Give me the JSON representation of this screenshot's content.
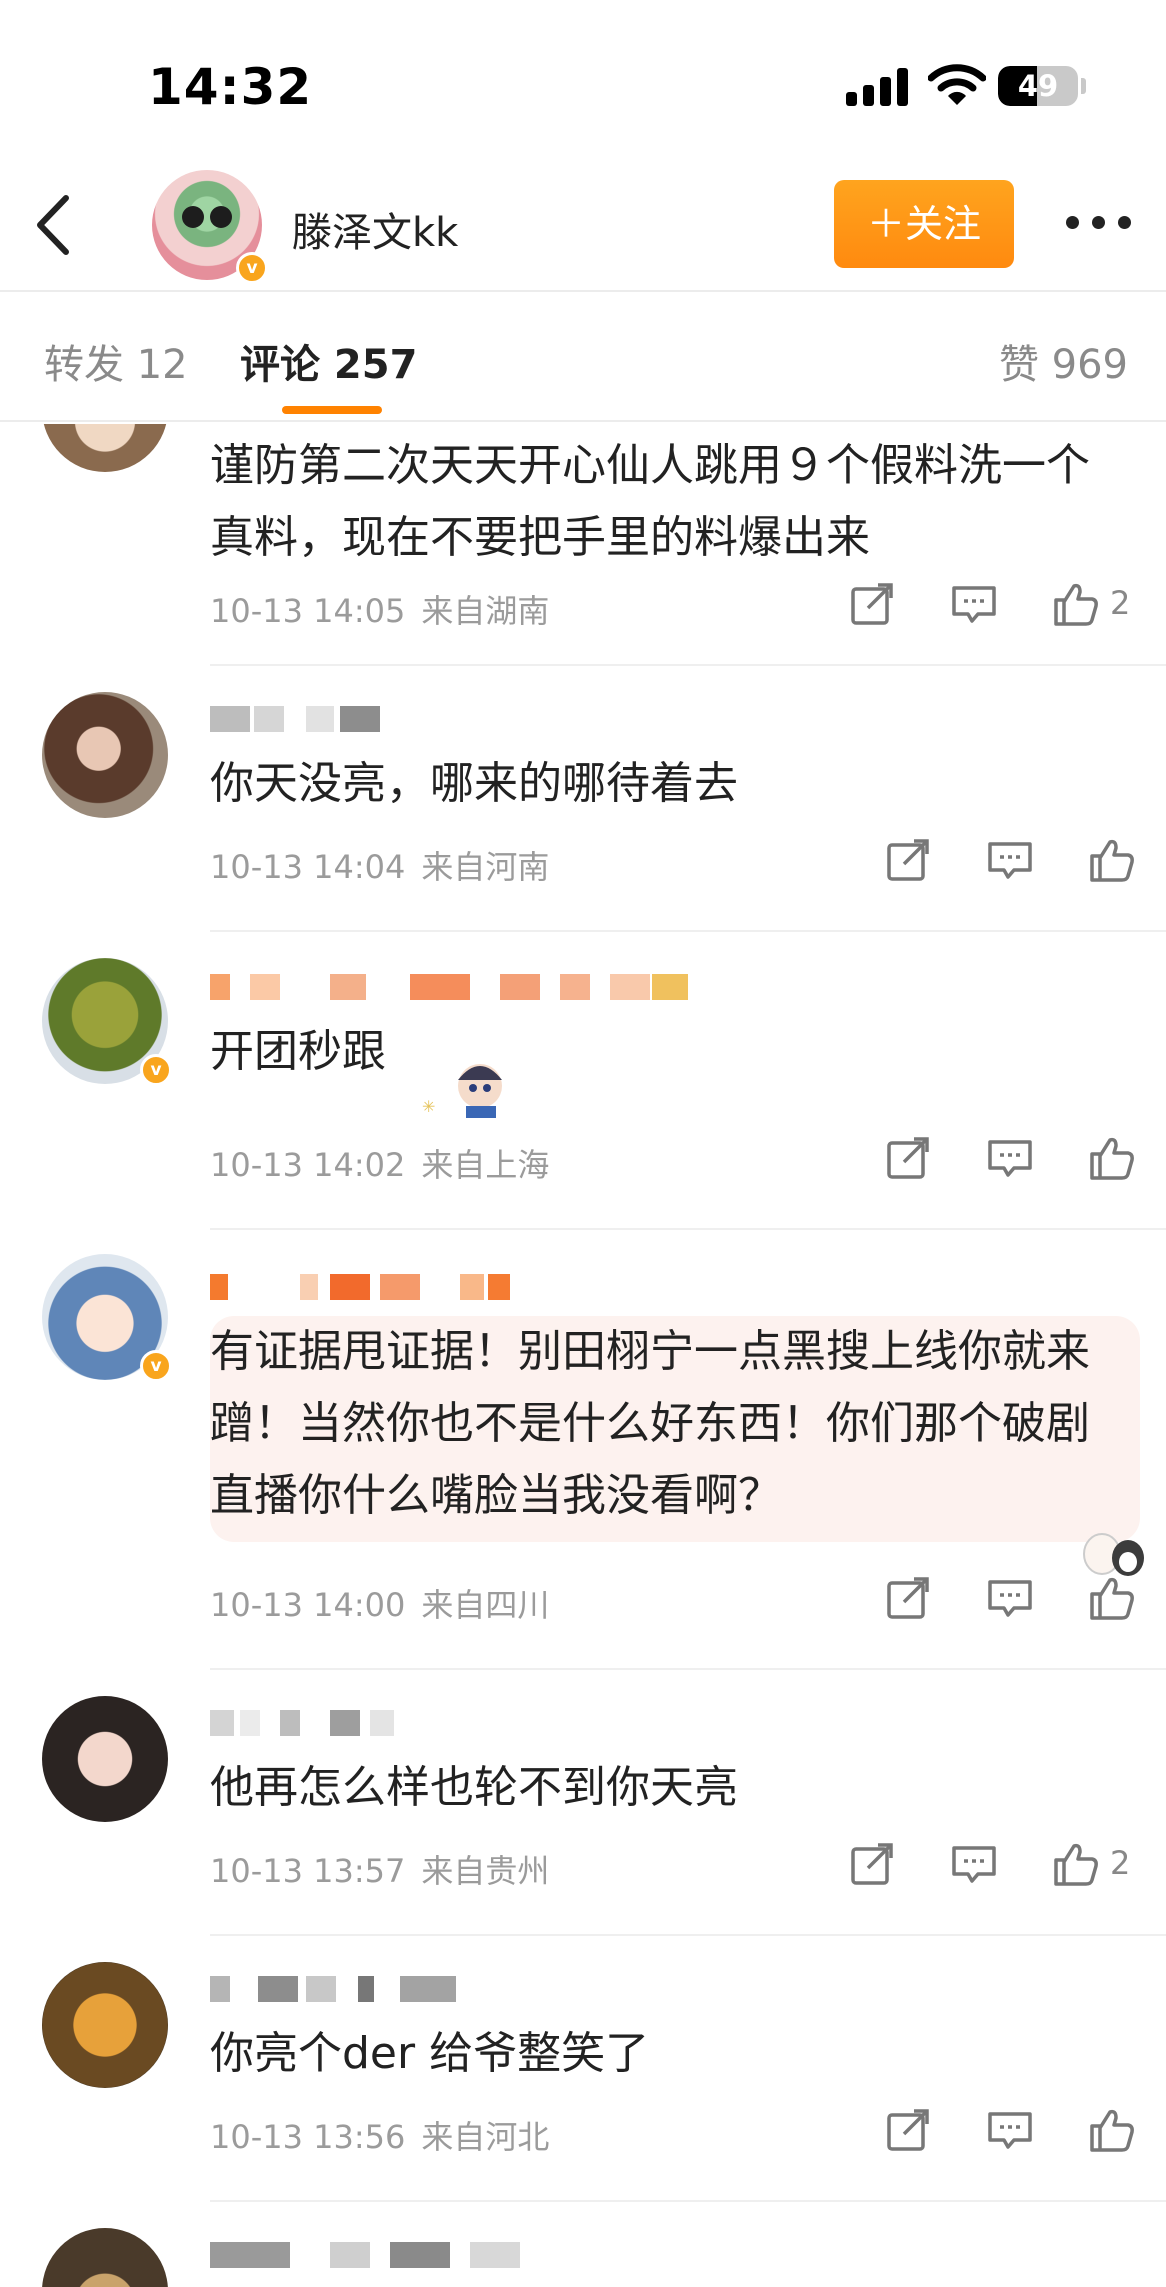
{
  "status_bar": {
    "time": "14:32",
    "battery": "49",
    "battery_level": 0.49
  },
  "header": {
    "profile_name": "滕泽文kk",
    "follow_label": "＋关注",
    "verified_mark": "v"
  },
  "tabs": {
    "repost": "转发 12",
    "comments": "评论 257",
    "likes": "赞 969"
  },
  "comments": [
    {
      "text": "谨防第二次天天开心仙人跳用９个假料洗一个真料，现在不要把手里的料爆出来",
      "time": "10-13 14:05",
      "location": "来自湖南",
      "likes": "2"
    },
    {
      "text": "你天没亮，哪来的哪待着去",
      "time": "10-13 14:04",
      "location": "来自河南",
      "likes": ""
    },
    {
      "text": "开团秒跟",
      "time": "10-13 14:02",
      "location": "来自上海",
      "likes": ""
    },
    {
      "text": "有证据甩证据！别田栩宁一点黑搜上线你就来蹭！当然你也不是什么好东西！你们那个破剧直播你什么嘴脸当我没看啊？",
      "time": "10-13 14:00",
      "location": "来自四川",
      "likes": ""
    },
    {
      "text": "他再怎么样也轮不到你天亮",
      "time": "10-13 13:57",
      "location": "来自贵州",
      "likes": "2"
    },
    {
      "text": "你亮个der 给爷整笑了",
      "time": "10-13 13:56",
      "location": "来自河北",
      "likes": ""
    }
  ],
  "colors": {
    "accent": "#ff8200",
    "follow_button": "#ff9a16",
    "meta_text": "#9b9b9b",
    "bubble": "#fdf2ef"
  },
  "icons": [
    "back-icon",
    "signal-icon",
    "wifi-icon",
    "battery-icon",
    "more-icon",
    "share-icon",
    "comment-icon",
    "like-icon"
  ]
}
